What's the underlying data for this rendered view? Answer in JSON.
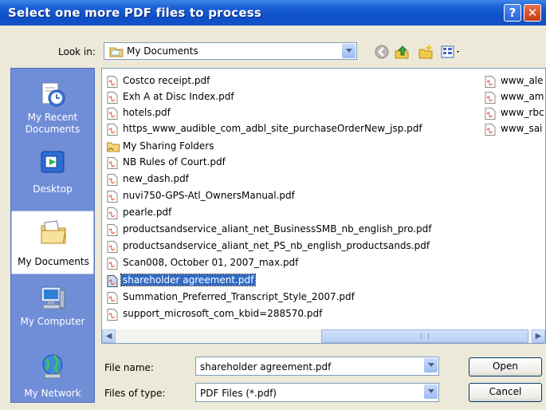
{
  "window": {
    "title": "Select one more PDF files to process",
    "help_label": "?",
    "close_label": "✕"
  },
  "lookin": {
    "label": "Look in:",
    "value": "My Documents"
  },
  "toolbar": {
    "icons": [
      "back-icon",
      "up-folder-icon",
      "new-folder-icon",
      "view-menu-icon"
    ]
  },
  "places": [
    {
      "label": "My Recent Documents",
      "icon": "recent-documents-icon"
    },
    {
      "label": "Desktop",
      "icon": "desktop-icon"
    },
    {
      "label": "My Documents",
      "icon": "my-documents-icon"
    },
    {
      "label": "My Computer",
      "icon": "my-computer-icon"
    },
    {
      "label": "My Network",
      "icon": "my-network-icon"
    }
  ],
  "files_col1": [
    "Costco receipt.pdf",
    "Exh A at Disc Index.pdf",
    "hotels.pdf",
    "https_www_audible_com_adbl_site_purchaseOrderNew_jsp.pdf",
    "My Sharing Folders",
    "NB Rules of Court.pdf",
    "new_dash.pdf",
    "nuvi750-GPS-Atl_OwnersManual.pdf",
    "pearle.pdf",
    "productsandservice_aliant_net_BusinessSMB_nb_english_pro.pdf",
    "productsandservice_aliant_net_PS_nb_english_productsands.pdf",
    "Scan008, October 01, 2007_max.pdf",
    "shareholder agreement.pdf",
    "Summation_Preferred_Transcript_Style_2007.pdf",
    "support_microsoft_com_kbid=288570.pdf"
  ],
  "files_col2": [
    "www_ale",
    "www_am",
    "www_rbc",
    "www_sai"
  ],
  "selected_file": "shareholder agreement.pdf",
  "filename": {
    "label": "File name:",
    "value": "shareholder agreement.pdf"
  },
  "filetype": {
    "label": "Files of type:",
    "value": "PDF Files (*.pdf)"
  },
  "buttons": {
    "open": "Open",
    "cancel": "Cancel"
  },
  "colors": {
    "titlebar": "#0d4fc7",
    "places_panel": "#6f8ed7",
    "selection": "#316ac5",
    "dialog_bg": "#ece9d8"
  }
}
